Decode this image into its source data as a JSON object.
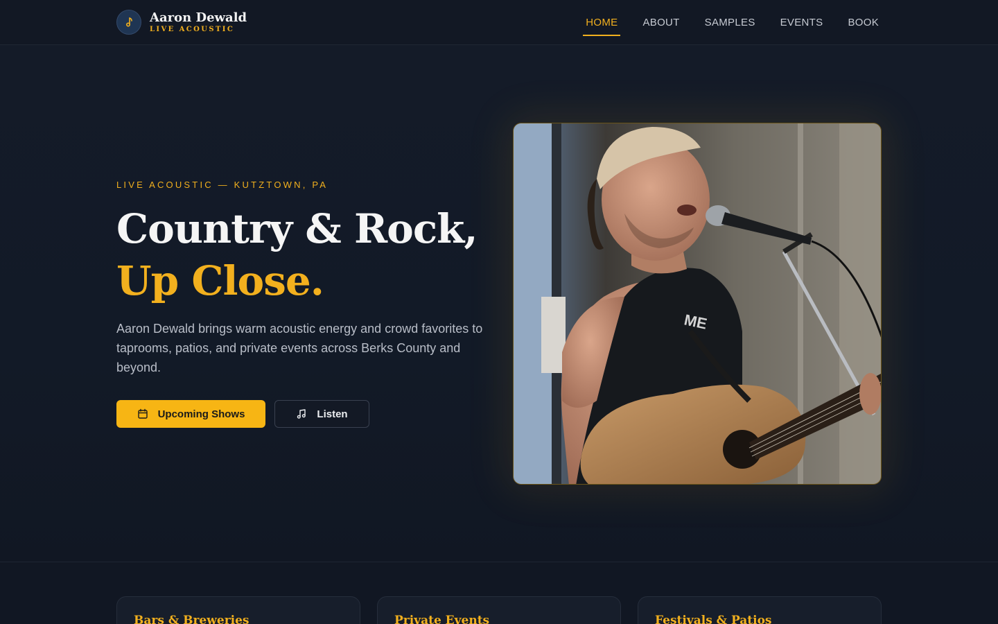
{
  "brand": {
    "name": "Aaron Dewald",
    "tagline": "LIVE ACOUSTIC",
    "logo_icon": "music-note-icon"
  },
  "nav": {
    "items": [
      {
        "label": "HOME",
        "active": true
      },
      {
        "label": "ABOUT",
        "active": false
      },
      {
        "label": "SAMPLES",
        "active": false
      },
      {
        "label": "EVENTS",
        "active": false
      },
      {
        "label": "BOOK",
        "active": false
      }
    ]
  },
  "hero": {
    "eyebrow": "LIVE ACOUSTIC — KUTZTOWN, PA",
    "title_line1": "Country & Rock,",
    "title_line2": "Up Close.",
    "lead": "Aaron Dewald brings warm acoustic energy and crowd favorites to taprooms, patios, and private events across Berks County and beyond.",
    "primary_button": {
      "label": "Upcoming Shows",
      "icon": "calendar-icon"
    },
    "secondary_button": {
      "label": "Listen",
      "icon": "music-note-icon"
    },
    "photo_alt": "Aaron Dewald singing with acoustic guitar"
  },
  "cards": [
    {
      "title": "Bars & Breweries"
    },
    {
      "title": "Private Events"
    },
    {
      "title": "Festivals & Patios"
    }
  ],
  "colors": {
    "accent": "#f2b01e",
    "background": "#111723",
    "text": "#f5f5f5"
  }
}
